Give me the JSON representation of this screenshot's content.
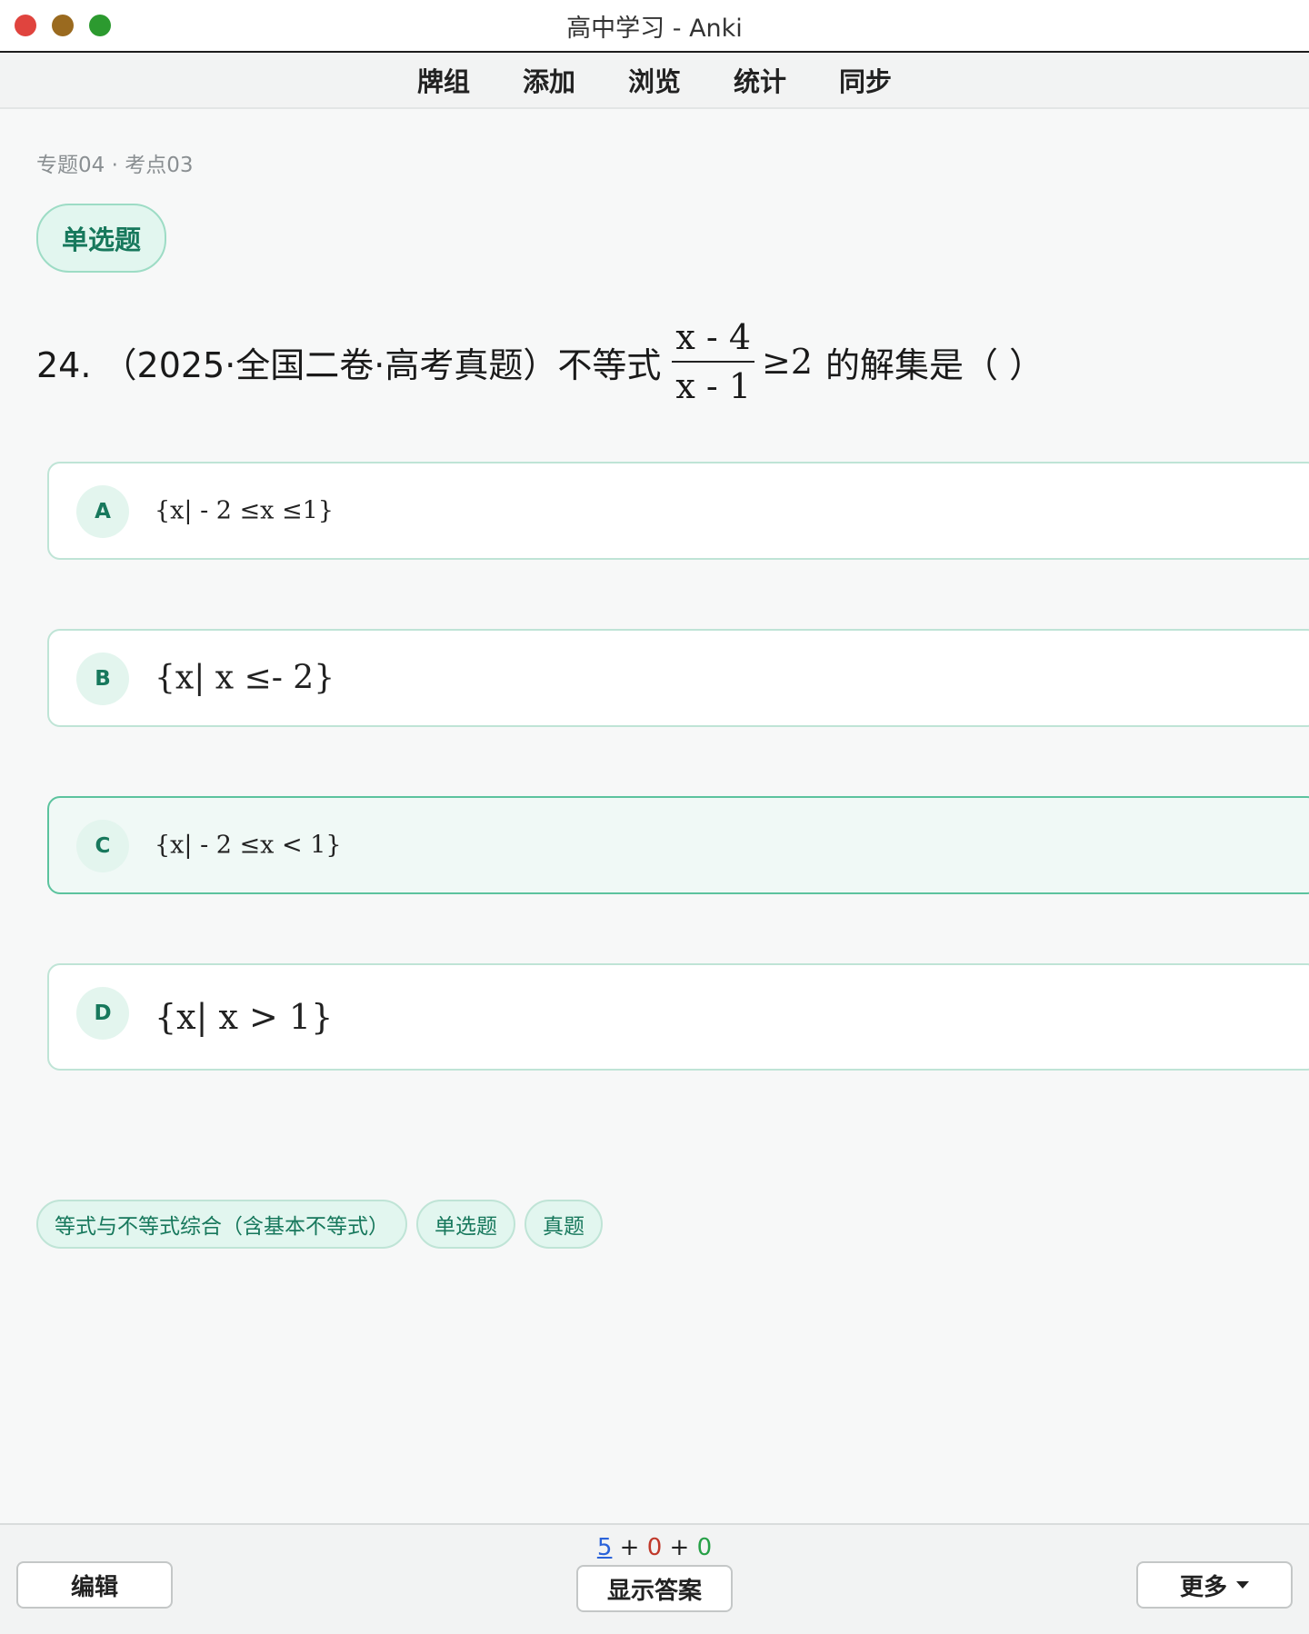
{
  "window": {
    "title": "高中学习 - Anki"
  },
  "toolbar": {
    "items": [
      "牌组",
      "添加",
      "浏览",
      "统计",
      "同步"
    ]
  },
  "card": {
    "breadcrumb": "专题04 · 考点03",
    "type_label": "单选题",
    "question_prefix": "24. （2025·全国二卷·高考真题）不等式",
    "fraction_numerator": "x - 4",
    "fraction_denominator": "x - 1",
    "question_relation": "≥2",
    "question_suffix": "的解集是（ ）",
    "options": [
      {
        "letter": "A",
        "text": "{x| - 2 ≤x ≤1}"
      },
      {
        "letter": "B",
        "text": "{x|  x ≤- 2}"
      },
      {
        "letter": "C",
        "text": "{x| - 2 ≤x < 1}"
      },
      {
        "letter": "D",
        "text": "{x|  x > 1}"
      }
    ],
    "tags": [
      "等式与不等式综合（含基本不等式）",
      "单选题",
      "真题"
    ]
  },
  "bottombar": {
    "edit_label": "编辑",
    "show_answer_label": "显示答案",
    "more_label": "更多",
    "count_new": "5",
    "count_learn": "0",
    "count_review": "0",
    "plus": "+"
  },
  "colors": {
    "accent": "#17785c",
    "pill_bg": "#e2f6ef",
    "count_new": "#2a62d9",
    "count_learn": "#c0392b",
    "count_review": "#27a047"
  }
}
